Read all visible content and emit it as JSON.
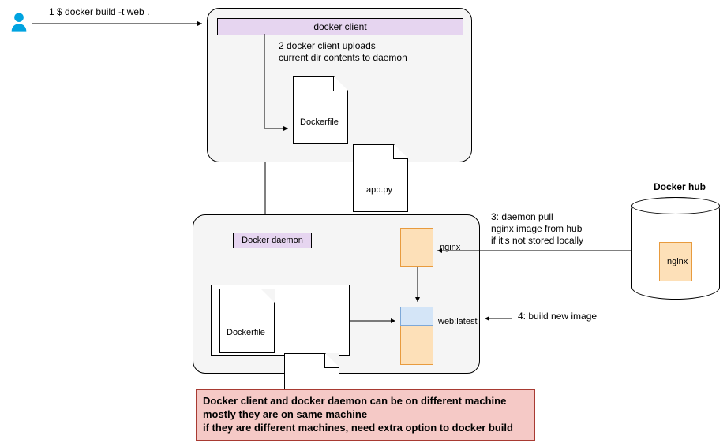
{
  "step1": "1 $ docker build -t web .",
  "client_label": "docker client",
  "step2_line1": "2 docker client uploads",
  "step2_line2": "current dir contents to daemon",
  "file1": "Dockerfile",
  "file2": "app.py",
  "daemon_label": "Docker daemon",
  "nginx_label": "nginx",
  "weblatest_label": "web:latest",
  "step3_line1": "3: daemon pull",
  "step3_line2": "nginx image from hub",
  "step3_line3": "if it's not stored locally",
  "step4": "4: build new image",
  "hub_title": "Docker hub",
  "hub_image": "nginx",
  "note_line1": "Docker client and docker daemon can be on different machine",
  "note_line2": "mostly they are on same machine",
  "note_line3": "if they are different machines, need extra option to docker build"
}
